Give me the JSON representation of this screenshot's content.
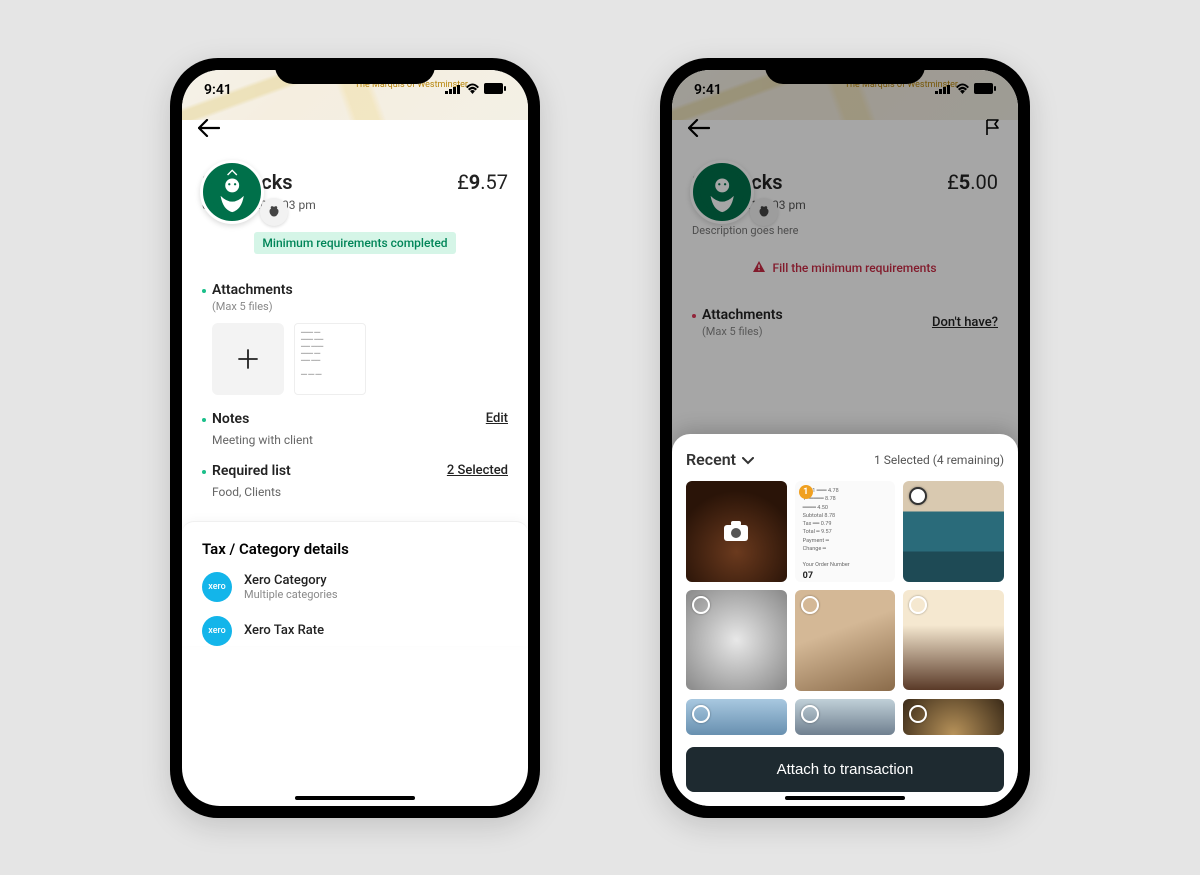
{
  "status_time": "9:41",
  "phone1": {
    "merchant": "Starbucks",
    "amount_symbol": "£",
    "amount_whole": "9",
    "amount_dec": ".57",
    "datetime": "02 Apr 2020, 3:03 pm",
    "requirement_banner": "Minimum requirements completed",
    "attachments": {
      "title": "Attachments",
      "hint": "(Max 5 files)"
    },
    "notes": {
      "title": "Notes",
      "edit": "Edit",
      "body": "Meeting with client"
    },
    "required_list": {
      "title": "Required list",
      "link": "2 Selected",
      "body": "Food, Clients"
    },
    "tax": {
      "heading": "Tax / Category details",
      "row1_label": "Xero Category",
      "row1_sub": "Multiple categories",
      "row2_label": "Xero Tax Rate"
    }
  },
  "phone2": {
    "merchant": "Starbucks",
    "amount_symbol": "£",
    "amount_whole": "5",
    "amount_dec": ".00",
    "datetime": "15 Apr 2021, 3:03 pm",
    "description": "Description goes here",
    "requirement_banner": "Fill the minimum requirements",
    "attachments": {
      "title": "Attachments",
      "link": "Don't have?",
      "hint": "(Max 5 files)"
    },
    "sheet": {
      "title": "Recent",
      "count": "1 Selected (4 remaining)",
      "button": "Attach to transaction"
    }
  }
}
